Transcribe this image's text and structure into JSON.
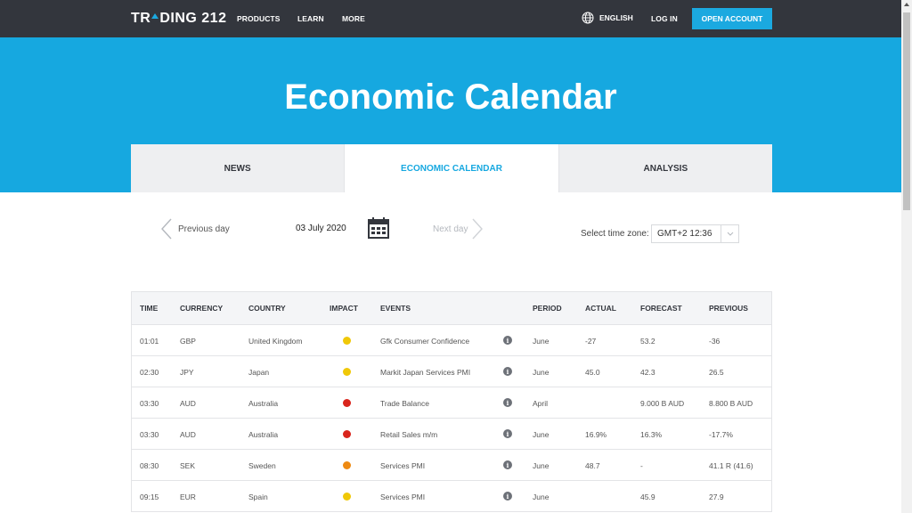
{
  "nav": {
    "logo_pre": "TR",
    "logo_post": "DING 212",
    "products": "PRODUCTS",
    "learn": "LEARN",
    "more": "MORE",
    "language": "ENGLISH",
    "login": "LOG IN",
    "open_account": "OPEN ACCOUNT"
  },
  "hero": {
    "title": "Economic Calendar"
  },
  "tabs": [
    {
      "label": "NEWS",
      "active": false
    },
    {
      "label": "ECONOMIC CALENDAR",
      "active": true
    },
    {
      "label": "ANALYSIS",
      "active": false
    }
  ],
  "datenav": {
    "prev": "Previous day",
    "date": "03 July 2020",
    "next": "Next day",
    "tz_label": "Select time zone:",
    "tz_value": "GMT+2 12:36"
  },
  "table": {
    "headers": [
      "TIME",
      "CURRENCY",
      "COUNTRY",
      "IMPACT",
      "EVENTS",
      "PERIOD",
      "ACTUAL",
      "FORECAST",
      "PREVIOUS"
    ],
    "rows": [
      {
        "time": "01:01",
        "currency": "GBP",
        "country": "United Kingdom",
        "impact": "#f0c808",
        "event": "Gfk Consumer Confidence",
        "period": "June",
        "actual": "-27",
        "forecast": "53.2",
        "previous": "-36"
      },
      {
        "time": "02:30",
        "currency": "JPY",
        "country": "Japan",
        "impact": "#f0c808",
        "event": "Markit Japan Services PMI",
        "period": "June",
        "actual": "45.0",
        "forecast": "42.3",
        "previous": "26.5"
      },
      {
        "time": "03:30",
        "currency": "AUD",
        "country": "Australia",
        "impact": "#d9251c",
        "event": "Trade Balance",
        "period": "April",
        "actual": "",
        "forecast": "9.000 B AUD",
        "previous": "8.800 B AUD"
      },
      {
        "time": "03:30",
        "currency": "AUD",
        "country": "Australia",
        "impact": "#d9251c",
        "event": "Retail Sales m/m",
        "period": "June",
        "actual": "16.9%",
        "forecast": "16.3%",
        "previous": "-17.7%"
      },
      {
        "time": "08:30",
        "currency": "SEK",
        "country": "Sweden",
        "impact": "#ee8a12",
        "event": "Services PMI",
        "period": "June",
        "actual": "48.7",
        "forecast": "-",
        "previous": "41.1 R (41.6)"
      },
      {
        "time": "09:15",
        "currency": "EUR",
        "country": "Spain",
        "impact": "#f0c808",
        "event": "Services PMI",
        "period": "June",
        "actual": "",
        "forecast": "45.9",
        "previous": "27.9"
      }
    ]
  },
  "colors": {
    "nav_bg": "#33363d",
    "accent": "#16a8e0"
  },
  "icons": {
    "globe": "globe-icon",
    "calendar": "calendar-icon",
    "info": "info-icon"
  }
}
